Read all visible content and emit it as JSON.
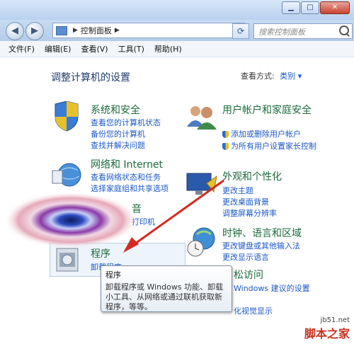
{
  "search": {
    "placeholder": "搜索控制面板"
  },
  "address": {
    "path": "控制面板"
  },
  "menu": [
    "文件(F)",
    "编辑(E)",
    "查看(V)",
    "工具(T)",
    "帮助(H)"
  ],
  "heading": "调整计算机的设置",
  "view_by": {
    "label": "查看方式:",
    "value": "类别"
  },
  "categories": {
    "system": {
      "title": "系统和安全",
      "links": [
        "查看您的计算机状态",
        "备份您的计算机",
        "查找并解决问题"
      ]
    },
    "network": {
      "title": "网络和 Internet",
      "links": [
        "查看网络状态和任务",
        "选择家庭组和共享选项"
      ]
    },
    "hardware": {
      "title_fragment": "音",
      "link_fragment": "打印机"
    },
    "programs": {
      "title": "程序",
      "link": "卸载程序"
    },
    "user": {
      "title": "用户帐户和家庭安全",
      "links": [
        "添加或删除用户帐户",
        "为所有用户设置家长控制"
      ]
    },
    "appearance": {
      "title": "外观和个性化",
      "links": [
        "更改主题",
        "更改桌面背景",
        "调整屏幕分辨率"
      ]
    },
    "clock": {
      "title": "时钟、语言和区域",
      "links": [
        "更改键盘或其他输入法",
        "更改显示语言"
      ]
    },
    "ease": {
      "title_fragment": "松访问",
      "link_fragment": "Windows 建议的设置",
      "link_fragment2": "化视觉显示"
    }
  },
  "tooltip": {
    "title": "程序",
    "body": "卸载程序或 Windows 功能、卸载小工具、从网络或通过联机获取新程序，等等。"
  },
  "watermark": {
    "site": "jb51.net",
    "brand": "脚本之家"
  },
  "colors": {
    "arrow": "#d42a1e",
    "link": "#1a57c8",
    "category": "#1a6a3a"
  }
}
